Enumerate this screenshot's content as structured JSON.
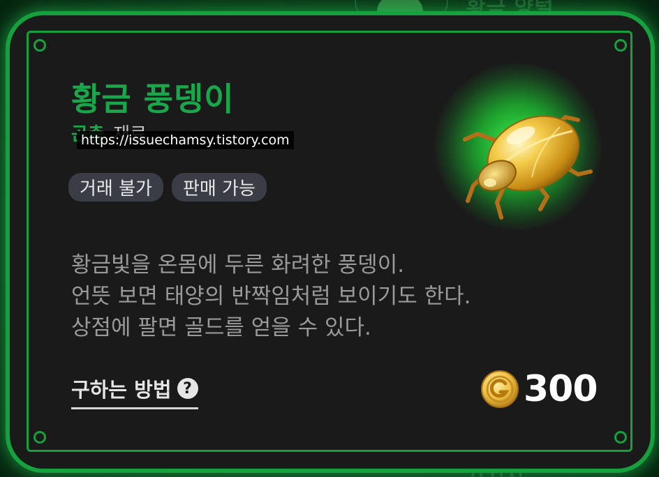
{
  "background": {
    "top_text": "황금 양털",
    "bottom_text": "사진집"
  },
  "item": {
    "name": "황금 풍뎅이",
    "category_type": "곤충",
    "category_name": "재료",
    "tags": [
      "거래 불가",
      "판매 가능"
    ],
    "description_lines": [
      "황금빛을 온몸에 두른 화려한 풍뎅이.",
      "언뜻 보면 태양의 반짝임처럼 보이기도 한다.",
      "상점에 팔면 골드를 얻을 수 있다."
    ],
    "image_icon": "golden-beetle-icon",
    "how_to_label": "구하는 방법",
    "help_icon": "question-icon",
    "price": "300",
    "currency_icon": "gold-coin-icon"
  },
  "watermark": "https://issuechamsy.tistory.com",
  "colors": {
    "accent_green": "#1aa64a",
    "frame_green": "#15a23e",
    "card_bg": "#1a1a1a",
    "tag_bg": "#3a3d45",
    "gold": "#f0c24a"
  }
}
